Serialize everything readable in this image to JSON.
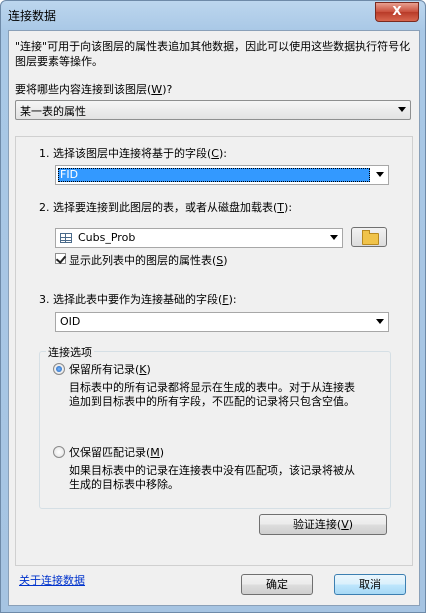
{
  "window": {
    "title": "连接数据",
    "close_glyph": "X"
  },
  "description": "\"连接\"可用于向该图层的属性表追加其他数据，因此可以使用这些数据执行符号化图层要素等操作。",
  "question": {
    "label": "要将哪些内容连接到该图层(W)?",
    "text": "要将哪些内容连接到该图层(",
    "key": "W",
    "suffix": ")?"
  },
  "join_type": {
    "selected": "某一表的属性"
  },
  "step1": {
    "text": "1. 选择该图层中连接将基于的字段(",
    "key": "C",
    "suffix": "):",
    "field_value": "FID"
  },
  "step2": {
    "text": "2. 选择要连接到此图层的表，或者从磁盘加载表(",
    "key": "T",
    "suffix": "):",
    "table_value": "Cubs_Prob",
    "show_attr_text": "显示此列表中的图层的属性表(",
    "show_attr_key": "S",
    "show_attr_suffix": ")",
    "show_attr_checked": true
  },
  "step3": {
    "text": "3. 选择此表中要作为连接基础的字段(",
    "key": "F",
    "suffix": "):",
    "field_value": "OID"
  },
  "options": {
    "title": "连接选项",
    "keep_all": {
      "text": "保留所有记录(",
      "key": "K",
      "suffix": ")",
      "checked": true,
      "desc1": "目标表中的所有记录都将显示在生成的表中。对于从连接表",
      "desc2": "追加到目标表中的所有字段，不匹配的记录将只包含空值。"
    },
    "keep_match": {
      "text": "仅保留匹配记录(",
      "key": "M",
      "suffix": ")",
      "checked": false,
      "desc1": "如果目标表中的记录在连接表中没有匹配项，该记录将被从",
      "desc2": "生成的目标表中移除。"
    }
  },
  "validate_button": {
    "text": "验证连接(",
    "key": "V",
    "suffix": ")"
  },
  "footer": {
    "about_link": "关于连接数据",
    "ok_label": "确定",
    "cancel_label": "取消"
  }
}
